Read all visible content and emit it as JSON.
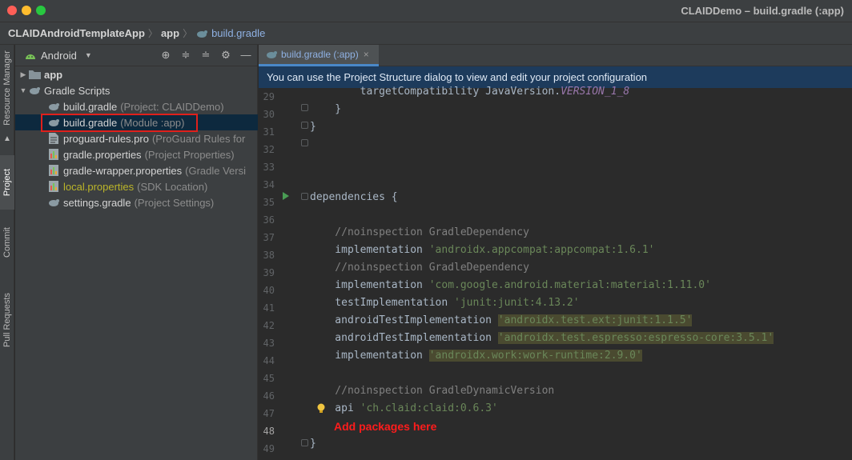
{
  "window": {
    "title": "CLAIDDemo – build.gradle (:app)"
  },
  "breadcrumbs": [
    {
      "label": "CLAIDAndroidTemplateApp"
    },
    {
      "label": "app"
    },
    {
      "label": "build.gradle"
    }
  ],
  "left_strip": {
    "tabs": [
      "Resource Manager",
      "Project",
      "Commit",
      "Pull Requests"
    ]
  },
  "project_panel": {
    "view_selector": "Android",
    "tree": [
      {
        "label": "app",
        "hint": ""
      },
      {
        "label": "Gradle Scripts",
        "hint": ""
      },
      {
        "label": "build.gradle",
        "hint": "(Project: CLAIDDemo)"
      },
      {
        "label": "build.gradle",
        "hint": "(Module :app)"
      },
      {
        "label": "proguard-rules.pro",
        "hint": "(ProGuard Rules for"
      },
      {
        "label": "gradle.properties",
        "hint": "(Project Properties)"
      },
      {
        "label": "gradle-wrapper.properties",
        "hint": "(Gradle Versi"
      },
      {
        "label": "local.properties",
        "hint": "(SDK Location)"
      },
      {
        "label": "settings.gradle",
        "hint": "(Project Settings)"
      }
    ]
  },
  "editor": {
    "tab_label": "build.gradle (:app)",
    "banner": "You can use the Project Structure dialog to view and edit your project configuration",
    "line_numbers": [
      "29",
      "30",
      "31",
      "32",
      "33",
      "34",
      "35",
      "36",
      "37",
      "38",
      "39",
      "40",
      "41",
      "42",
      "43",
      "44",
      "45",
      "46",
      "47",
      "48",
      "49"
    ],
    "code": {
      "l29_a": "        targetCompatibility JavaVersion.",
      "l29_b": "VERSION_1_8",
      "l30": "    }",
      "l31": "}",
      "l35": "dependencies {",
      "l37": "    //noinspection GradleDependency",
      "l38_a": "    implementation ",
      "l38_b": "'androidx.appcompat:appcompat:1.6.1'",
      "l39": "    //noinspection GradleDependency",
      "l40_a": "    implementation ",
      "l40_b": "'com.google.android.material:material:1.11.0'",
      "l41_a": "    testImplementation ",
      "l41_b": "'junit:junit:4.13.2'",
      "l42_a": "    androidTestImplementation ",
      "l42_b": "'androidx.test.ext:junit:1.1.5'",
      "l43_a": "    androidTestImplementation ",
      "l43_b": "'androidx.test.espresso:espresso-core:3.5.1'",
      "l44_a": "    implementation ",
      "l44_b": "'androidx.work:work-runtime:2.9.0'",
      "l46": "    //noinspection GradleDynamicVersion",
      "l47_a": "    api ",
      "l47_b": "'ch.claid:claid:0.6.3'",
      "l48": "Add packages here",
      "l49": "}"
    },
    "annotation_color": "#ff1c1c"
  }
}
